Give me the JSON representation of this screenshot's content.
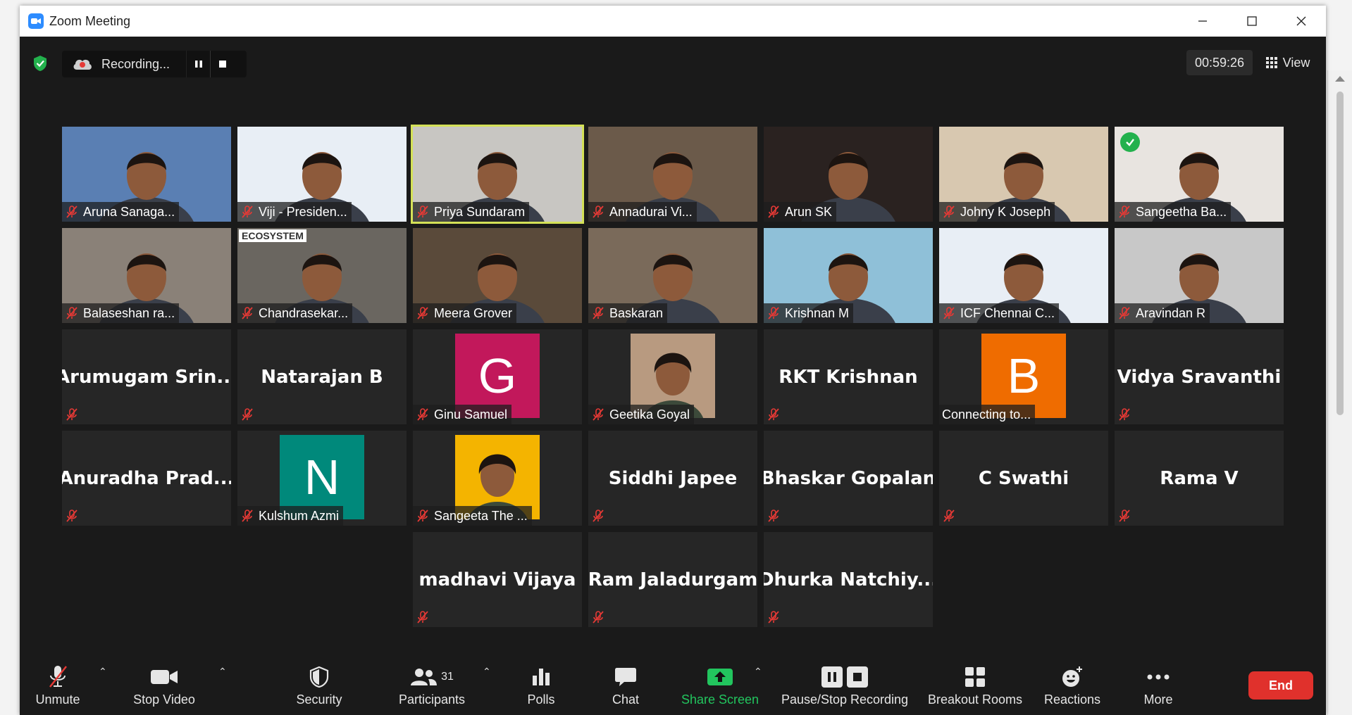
{
  "window": {
    "title": "Zoom Meeting"
  },
  "topbar": {
    "recording_label": "Recording...",
    "timer": "00:59:26",
    "view_label": "View"
  },
  "participants_row1": [
    {
      "name": "Aruna Sanaga...",
      "type": "video",
      "bg": "#5a7fb3"
    },
    {
      "name": "Viji - Presiden...",
      "type": "video",
      "bg": "#e8eef5"
    },
    {
      "name": "Priya Sundaram",
      "type": "video",
      "bg": "#c8c6c2",
      "active": true
    },
    {
      "name": "Annadurai Vi...",
      "type": "video",
      "bg": "#6b5a4a"
    },
    {
      "name": "Arun SK",
      "type": "video",
      "bg": "#2a2220"
    },
    {
      "name": "Johny K Joseph",
      "type": "video",
      "bg": "#d8c8b0"
    },
    {
      "name": "Sangeetha Ba...",
      "type": "video",
      "bg": "#e8e4e0",
      "check": true
    }
  ],
  "participants_row2": [
    {
      "name": "Balaseshan ra...",
      "type": "video",
      "bg": "#8a8178"
    },
    {
      "name": "Chandrasekar...",
      "type": "video",
      "bg": "#6a6660",
      "banner": "ECOSYSTEM"
    },
    {
      "name": "Meera Grover",
      "type": "video",
      "bg": "#5a4a3a"
    },
    {
      "name": "Baskaran",
      "type": "video",
      "bg": "#7a6a5a"
    },
    {
      "name": "Krishnan M",
      "type": "video",
      "bg": "#8fc0d8"
    },
    {
      "name": "ICF Chennai C...",
      "type": "video",
      "bg": "#e8eef5"
    },
    {
      "name": "Aravindan R",
      "type": "video",
      "bg": "#c8c8c8"
    }
  ],
  "participants_row3": [
    {
      "name": "Arumugam  Srin...",
      "type": "name"
    },
    {
      "name": "Natarajan B",
      "type": "name"
    },
    {
      "name": "Ginu Samuel",
      "type": "avatar",
      "letter": "G",
      "color": "#c2185b"
    },
    {
      "name": "Geetika Goyal",
      "type": "photo-avatar",
      "bg": "#b89a80"
    },
    {
      "name": "RKT Krishnan",
      "type": "name"
    },
    {
      "name": "Connecting to...",
      "type": "avatar",
      "letter": "B",
      "color": "#ef6c00"
    },
    {
      "name": "Vidya Sravanthi",
      "type": "name"
    }
  ],
  "participants_row4": [
    {
      "name": "Anuradha  Prad...",
      "type": "name"
    },
    {
      "name": "Kulshum Azmi",
      "type": "avatar",
      "letter": "N",
      "color": "#00897b"
    },
    {
      "name": "Sangeeta The ...",
      "type": "photo-avatar",
      "bg": "#f4b400"
    },
    {
      "name": "Siddhi Japee",
      "type": "name"
    },
    {
      "name": "Bhaskar Gopalan",
      "type": "name"
    },
    {
      "name": "C Swathi",
      "type": "name"
    },
    {
      "name": "Rama V",
      "type": "name"
    }
  ],
  "participants_row5": [
    {
      "name": "madhavi Vijaya",
      "type": "name"
    },
    {
      "name": "Ram Jaladurgam",
      "type": "name"
    },
    {
      "name": "Dhurka  Natchiy...",
      "type": "name"
    }
  ],
  "toolbar": {
    "unmute": "Unmute",
    "stop_video": "Stop Video",
    "security": "Security",
    "participants": "Participants",
    "participants_count": "31",
    "polls": "Polls",
    "chat": "Chat",
    "share_screen": "Share Screen",
    "pause_stop_recording": "Pause/Stop Recording",
    "breakout_rooms": "Breakout Rooms",
    "reactions": "Reactions",
    "more": "More",
    "end": "End"
  },
  "colors": {
    "accent_active": "#d4e157",
    "share_green": "#22c55e",
    "end_red": "#e0312c",
    "mute_red": "#e53935"
  }
}
